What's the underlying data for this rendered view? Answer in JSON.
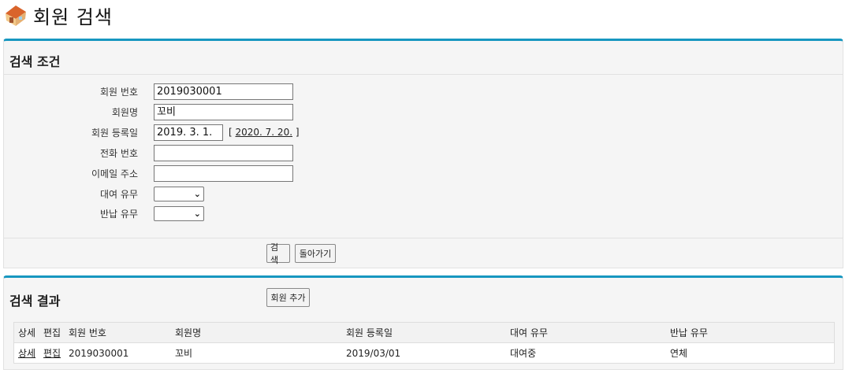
{
  "page": {
    "title": "회원 검색"
  },
  "criteria": {
    "title": "검색 조건",
    "fields": [
      {
        "label": "회원 번호",
        "value": "2019030001"
      },
      {
        "label": "회원명",
        "value": "꼬비"
      },
      {
        "label": "회원 등록일",
        "value": "2019. 3. 1.",
        "link_prefix": "[ ",
        "link_text": "2020. 7. 20.",
        "link_suffix": " ]"
      },
      {
        "label": "전화 번호",
        "value": ""
      },
      {
        "label": "이메일 주소",
        "value": ""
      },
      {
        "label": "대여 유무",
        "value": ""
      },
      {
        "label": "반납 유무",
        "value": ""
      }
    ],
    "search_button": "검색",
    "back_button": "돌아가기"
  },
  "results": {
    "title": "검색 결과",
    "add_button": "회원 추가",
    "columns": [
      "상세",
      "편집",
      "회원 번호",
      "회원명",
      "회원 등록일",
      "대여 유무",
      "반납 유무"
    ],
    "rows": [
      [
        "상세",
        "편집",
        "2019030001",
        "꼬비",
        "2019/03/01",
        "대여중",
        "연체"
      ]
    ]
  },
  "colors": {
    "accent": "#1797c0",
    "panel_bg": "#f5f5f5",
    "table_header_bg": "#f2f2f2"
  },
  "icons": {
    "page_icon": "house-icon",
    "dropdown": "chevron-down-icon"
  }
}
